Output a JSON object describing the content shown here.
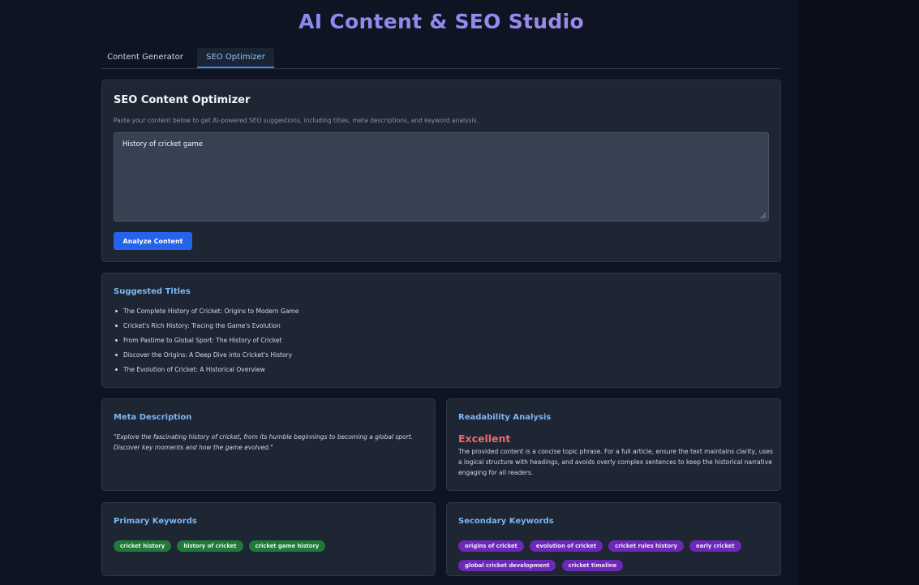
{
  "app": {
    "title": "AI Content & SEO Studio"
  },
  "tabs": [
    {
      "label": "Content Generator",
      "active": false
    },
    {
      "label": "SEO Optimizer",
      "active": true
    }
  ],
  "optimizer": {
    "heading": "SEO Content Optimizer",
    "description": "Paste your content below to get AI-powered SEO suggestions, including titles, meta descriptions, and keyword analysis.",
    "input_value": "History of cricket game",
    "button_label": "Analyze Content"
  },
  "suggested_titles": {
    "heading": "Suggested Titles",
    "items": [
      "The Complete History of Cricket: Origins to Modern Game",
      "Cricket's Rich History: Tracing the Game's Evolution",
      "From Pastime to Global Sport: The History of Cricket",
      "Discover the Origins: A Deep Dive into Cricket's History",
      "The Evolution of Cricket: A Historical Overview"
    ]
  },
  "meta_description": {
    "heading": "Meta Description",
    "text": "\"Explore the fascinating history of cricket, from its humble beginnings to becoming a global sport. Discover key moments and how the game evolved.\""
  },
  "readability": {
    "heading": "Readability Analysis",
    "score": "Excellent",
    "text": "The provided content is a concise topic phrase. For a full article, ensure the text maintains clarity, uses a logical structure with headings, and avoids overly complex sentences to keep the historical narrative engaging for all readers."
  },
  "primary_keywords": {
    "heading": "Primary Keywords",
    "items": [
      "cricket history",
      "history of cricket",
      "cricket game history"
    ]
  },
  "secondary_keywords": {
    "heading": "Secondary Keywords",
    "items": [
      "origins of cricket",
      "evolution of cricket",
      "cricket rules history",
      "early cricket",
      "global cricket development",
      "cricket timeline"
    ]
  },
  "colors": {
    "accent": "#2563eb",
    "heading_blue": "#7cb7f5",
    "score_red": "#f06a6a",
    "primary_tag": "#1f7a3a",
    "secondary_tag": "#6d28b7"
  },
  "icons": {
    "resize_handle": "resize-grip-icon"
  }
}
